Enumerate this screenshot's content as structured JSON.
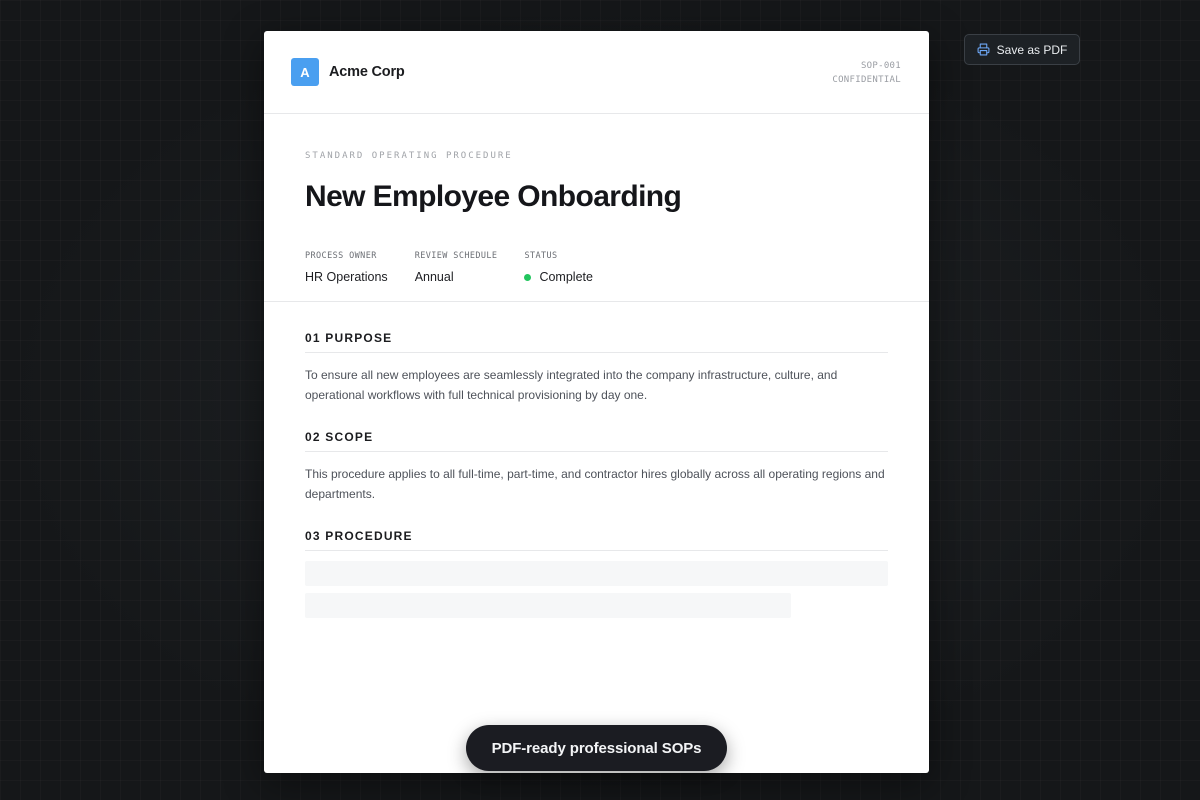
{
  "header": {
    "logo_letter": "A",
    "company": "Acme Corp",
    "doc_id": "SOP-001",
    "classification": "CONFIDENTIAL"
  },
  "hero": {
    "eyebrow": "STANDARD OPERATING PROCEDURE",
    "title": "New Employee Onboarding",
    "meta": [
      {
        "label": "PROCESS OWNER",
        "value": "HR Operations"
      },
      {
        "label": "REVIEW SCHEDULE",
        "value": "Annual"
      },
      {
        "label": "STATUS",
        "value": "Complete"
      }
    ]
  },
  "sections": [
    {
      "title": "01 PURPOSE",
      "text": "To ensure all new employees are seamlessly integrated into the company infrastructure, culture, and operational workflows with full technical provisioning by day one."
    },
    {
      "title": "02 SCOPE",
      "text": "This procedure applies to all full-time, part-time, and contractor hires globally across all operating regions and departments."
    },
    {
      "title": "03 PROCEDURE"
    }
  ],
  "toolbar": {
    "save_label": "Save as PDF",
    "save_icon": "printer-icon"
  },
  "banner": {
    "text": "PDF-ready professional SOPs"
  },
  "colors": {
    "accent": "#4a9ff0",
    "status_complete": "#22c55e",
    "background": "#151719"
  }
}
